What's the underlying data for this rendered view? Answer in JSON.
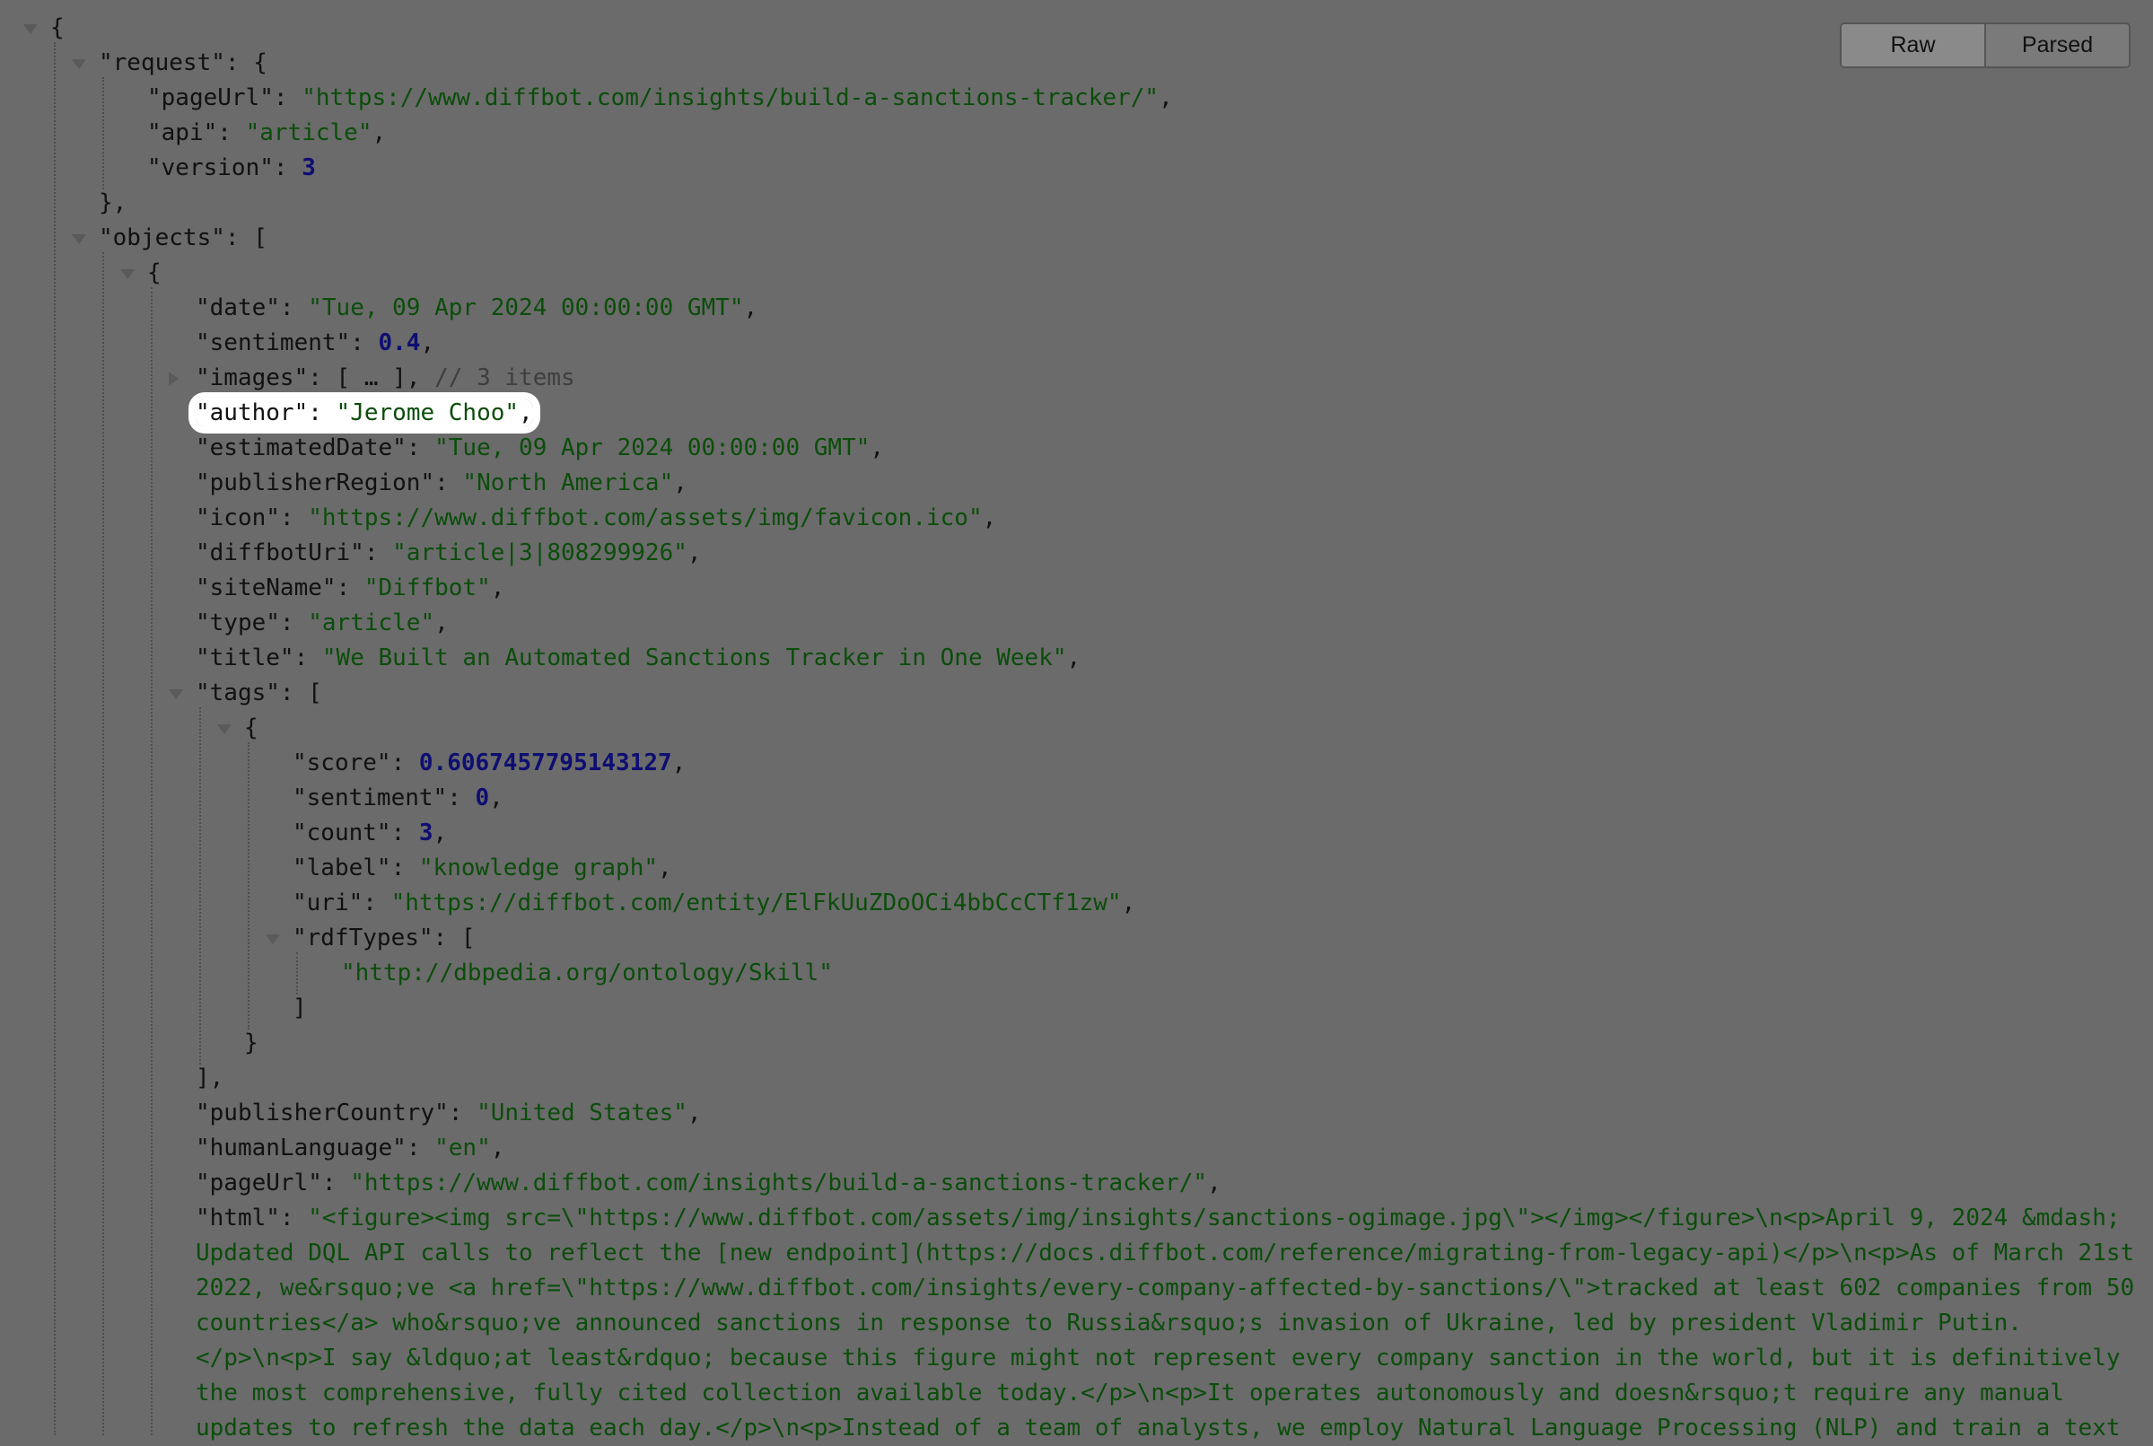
{
  "toolbar": {
    "raw_label": "Raw",
    "parsed_label": "Parsed"
  },
  "json_lines": [
    {
      "level": 0,
      "toggle": "open",
      "tokens": [
        [
          "p",
          "{"
        ]
      ]
    },
    {
      "level": 1,
      "toggle": "open",
      "tokens": [
        [
          "k",
          "\"request\""
        ],
        [
          "p",
          ": {"
        ]
      ]
    },
    {
      "level": 2,
      "tokens": [
        [
          "k",
          "\"pageUrl\""
        ],
        [
          "p",
          ": "
        ],
        [
          "s",
          "\"https://www.diffbot.com/insights/build-a-sanctions-tracker/\""
        ],
        [
          "p",
          ","
        ]
      ]
    },
    {
      "level": 2,
      "tokens": [
        [
          "k",
          "\"api\""
        ],
        [
          "p",
          ": "
        ],
        [
          "s",
          "\"article\""
        ],
        [
          "p",
          ","
        ]
      ]
    },
    {
      "level": 2,
      "tokens": [
        [
          "k",
          "\"version\""
        ],
        [
          "p",
          ": "
        ],
        [
          "n",
          "3"
        ]
      ]
    },
    {
      "level": 1,
      "tokens": [
        [
          "p",
          "},"
        ]
      ]
    },
    {
      "level": 1,
      "toggle": "open",
      "tokens": [
        [
          "k",
          "\"objects\""
        ],
        [
          "p",
          ": ["
        ]
      ]
    },
    {
      "level": 2,
      "toggle": "open",
      "tokens": [
        [
          "p",
          "{"
        ]
      ]
    },
    {
      "level": 3,
      "tokens": [
        [
          "k",
          "\"date\""
        ],
        [
          "p",
          ": "
        ],
        [
          "s",
          "\"Tue, 09 Apr 2024 00:00:00 GMT\""
        ],
        [
          "p",
          ","
        ]
      ]
    },
    {
      "level": 3,
      "tokens": [
        [
          "k",
          "\"sentiment\""
        ],
        [
          "p",
          ": "
        ],
        [
          "n",
          "0.4"
        ],
        [
          "p",
          ","
        ]
      ]
    },
    {
      "level": 3,
      "toggle": "closed",
      "tokens": [
        [
          "k",
          "\"images\""
        ],
        [
          "p",
          ": [ … ], "
        ],
        [
          "c",
          "// 3 items"
        ]
      ]
    },
    {
      "level": 3,
      "highlight": true,
      "tokens": [
        [
          "k",
          "\"author\""
        ],
        [
          "p",
          ": "
        ],
        [
          "s",
          "\"Jerome Choo\""
        ],
        [
          "p",
          ","
        ]
      ]
    },
    {
      "level": 3,
      "tokens": [
        [
          "k",
          "\"estimatedDate\""
        ],
        [
          "p",
          ": "
        ],
        [
          "s",
          "\"Tue, 09 Apr 2024 00:00:00 GMT\""
        ],
        [
          "p",
          ","
        ]
      ]
    },
    {
      "level": 3,
      "tokens": [
        [
          "k",
          "\"publisherRegion\""
        ],
        [
          "p",
          ": "
        ],
        [
          "s",
          "\"North America\""
        ],
        [
          "p",
          ","
        ]
      ]
    },
    {
      "level": 3,
      "tokens": [
        [
          "k",
          "\"icon\""
        ],
        [
          "p",
          ": "
        ],
        [
          "s",
          "\"https://www.diffbot.com/assets/img/favicon.ico\""
        ],
        [
          "p",
          ","
        ]
      ]
    },
    {
      "level": 3,
      "tokens": [
        [
          "k",
          "\"diffbotUri\""
        ],
        [
          "p",
          ": "
        ],
        [
          "s",
          "\"article|3|808299926\""
        ],
        [
          "p",
          ","
        ]
      ]
    },
    {
      "level": 3,
      "tokens": [
        [
          "k",
          "\"siteName\""
        ],
        [
          "p",
          ": "
        ],
        [
          "s",
          "\"Diffbot\""
        ],
        [
          "p",
          ","
        ]
      ]
    },
    {
      "level": 3,
      "tokens": [
        [
          "k",
          "\"type\""
        ],
        [
          "p",
          ": "
        ],
        [
          "s",
          "\"article\""
        ],
        [
          "p",
          ","
        ]
      ]
    },
    {
      "level": 3,
      "tokens": [
        [
          "k",
          "\"title\""
        ],
        [
          "p",
          ": "
        ],
        [
          "s",
          "\"We Built an Automated Sanctions Tracker in One Week\""
        ],
        [
          "p",
          ","
        ]
      ]
    },
    {
      "level": 3,
      "toggle": "open",
      "tokens": [
        [
          "k",
          "\"tags\""
        ],
        [
          "p",
          ": ["
        ]
      ]
    },
    {
      "level": 4,
      "toggle": "open",
      "tokens": [
        [
          "p",
          "{"
        ]
      ]
    },
    {
      "level": 5,
      "tokens": [
        [
          "k",
          "\"score\""
        ],
        [
          "p",
          ": "
        ],
        [
          "n",
          "0.6067457795143127"
        ],
        [
          "p",
          ","
        ]
      ]
    },
    {
      "level": 5,
      "tokens": [
        [
          "k",
          "\"sentiment\""
        ],
        [
          "p",
          ": "
        ],
        [
          "n",
          "0"
        ],
        [
          "p",
          ","
        ]
      ]
    },
    {
      "level": 5,
      "tokens": [
        [
          "k",
          "\"count\""
        ],
        [
          "p",
          ": "
        ],
        [
          "n",
          "3"
        ],
        [
          "p",
          ","
        ]
      ]
    },
    {
      "level": 5,
      "tokens": [
        [
          "k",
          "\"label\""
        ],
        [
          "p",
          ": "
        ],
        [
          "s",
          "\"knowledge graph\""
        ],
        [
          "p",
          ","
        ]
      ]
    },
    {
      "level": 5,
      "tokens": [
        [
          "k",
          "\"uri\""
        ],
        [
          "p",
          ": "
        ],
        [
          "s",
          "\"https://diffbot.com/entity/ElFkUuZDoOCi4bbCcCTf1zw\""
        ],
        [
          "p",
          ","
        ]
      ]
    },
    {
      "level": 5,
      "toggle": "open",
      "tokens": [
        [
          "k",
          "\"rdfTypes\""
        ],
        [
          "p",
          ": ["
        ]
      ]
    },
    {
      "level": 6,
      "tokens": [
        [
          "s",
          "\"http://dbpedia.org/ontology/Skill\""
        ]
      ]
    },
    {
      "level": 5,
      "tokens": [
        [
          "p",
          "]"
        ]
      ]
    },
    {
      "level": 4,
      "tokens": [
        [
          "p",
          "}"
        ]
      ]
    },
    {
      "level": 3,
      "tokens": [
        [
          "p",
          "],"
        ]
      ]
    },
    {
      "level": 3,
      "tokens": [
        [
          "k",
          "\"publisherCountry\""
        ],
        [
          "p",
          ": "
        ],
        [
          "s",
          "\"United States\""
        ],
        [
          "p",
          ","
        ]
      ]
    },
    {
      "level": 3,
      "tokens": [
        [
          "k",
          "\"humanLanguage\""
        ],
        [
          "p",
          ": "
        ],
        [
          "s",
          "\"en\""
        ],
        [
          "p",
          ","
        ]
      ]
    },
    {
      "level": 3,
      "tokens": [
        [
          "k",
          "\"pageUrl\""
        ],
        [
          "p",
          ": "
        ],
        [
          "s",
          "\"https://www.diffbot.com/insights/build-a-sanctions-tracker/\""
        ],
        [
          "p",
          ","
        ]
      ]
    },
    {
      "level": 3,
      "tokens": [
        [
          "k",
          "\"html\""
        ],
        [
          "p",
          ": "
        ],
        [
          "s",
          "\"<figure><img src=\\\"https://www.diffbot.com/assets/img/insights/sanctions-ogimage.jpg\\\"></img></figure>\\n<p>April 9, 2024 &mdash;"
        ]
      ]
    },
    {
      "level": 3,
      "tokens": [
        [
          "s",
          "Updated DQL API calls to reflect the [new endpoint](https://docs.diffbot.com/reference/migrating-from-legacy-api)</p>\\n<p>As of March 21st"
        ]
      ]
    },
    {
      "level": 3,
      "tokens": [
        [
          "s",
          "2022, we&rsquo;ve <a href=\\\"https://www.diffbot.com/insights/every-company-affected-by-sanctions/\\\">tracked at least 602 companies from 50"
        ]
      ]
    },
    {
      "level": 3,
      "tokens": [
        [
          "s",
          "countries</a> who&rsquo;ve announced sanctions in response to Russia&rsquo;s invasion of Ukraine, led by president Vladimir Putin."
        ]
      ]
    },
    {
      "level": 3,
      "tokens": [
        [
          "s",
          "</p>\\n<p>I say &ldquo;at least&rdquo; because this figure might not represent every company sanction in the world, but it is definitively"
        ]
      ]
    },
    {
      "level": 3,
      "tokens": [
        [
          "s",
          "the most comprehensive, fully cited collection available today.</p>\\n<p>It operates autonomously and doesn&rsquo;t require any manual"
        ]
      ]
    },
    {
      "level": 3,
      "tokens": [
        [
          "s",
          "updates to refresh the data each day.</p>\\n<p>Instead of a team of analysts, we employ Natural Language Processing (NLP) and train a text"
        ]
      ]
    }
  ]
}
